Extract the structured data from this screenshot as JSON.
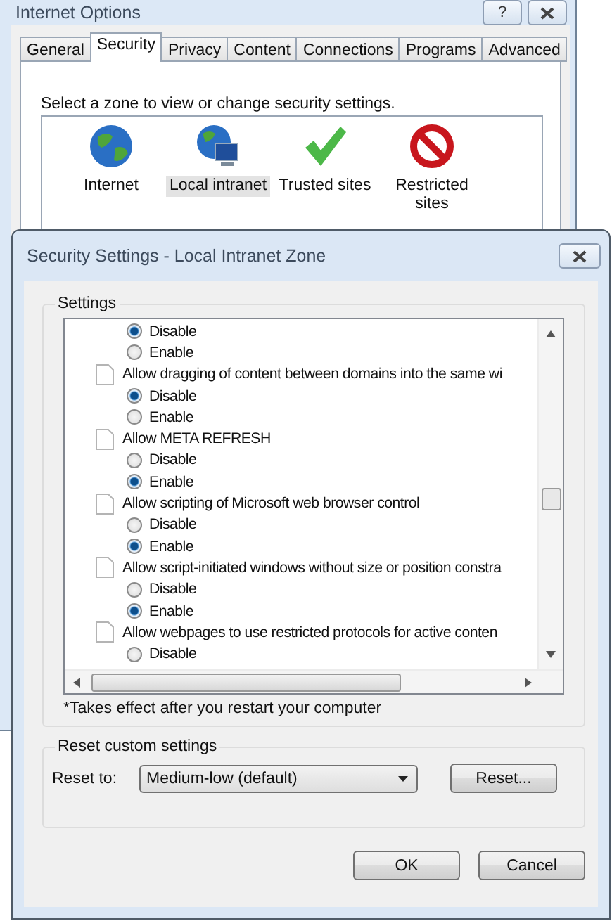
{
  "back_window": {
    "title": "Internet Options",
    "help": "?",
    "tabs": [
      {
        "label": "General",
        "selected": false
      },
      {
        "label": "Security",
        "selected": true
      },
      {
        "label": "Privacy",
        "selected": false
      },
      {
        "label": "Content",
        "selected": false
      },
      {
        "label": "Connections",
        "selected": false
      },
      {
        "label": "Programs",
        "selected": false
      },
      {
        "label": "Advanced",
        "selected": false
      }
    ],
    "prompt": "Select a zone to view or change security settings.",
    "zones": [
      {
        "kind": "globe",
        "label": "Internet",
        "selected": false
      },
      {
        "kind": "intranet",
        "label": "Local intranet",
        "selected": true
      },
      {
        "kind": "check",
        "label": "Trusted sites",
        "selected": false
      },
      {
        "kind": "blocked",
        "label": "Restricted sites",
        "selected": false
      }
    ]
  },
  "dialog": {
    "title": "Security Settings - Local Intranet Zone",
    "settings_label": "Settings",
    "items": [
      {
        "kind": "option",
        "label": "Disable",
        "selected": true
      },
      {
        "kind": "option",
        "label": "Enable",
        "selected": false
      },
      {
        "kind": "setting",
        "label": "Allow dragging of content between domains into the same wi"
      },
      {
        "kind": "option",
        "label": "Disable",
        "selected": true
      },
      {
        "kind": "option",
        "label": "Enable",
        "selected": false
      },
      {
        "kind": "setting",
        "label": "Allow META REFRESH"
      },
      {
        "kind": "option",
        "label": "Disable",
        "selected": false
      },
      {
        "kind": "option",
        "label": "Enable",
        "selected": true
      },
      {
        "kind": "setting",
        "label": "Allow scripting of Microsoft web browser control"
      },
      {
        "kind": "option",
        "label": "Disable",
        "selected": false
      },
      {
        "kind": "option",
        "label": "Enable",
        "selected": true
      },
      {
        "kind": "setting",
        "label": "Allow script-initiated windows without size or position constra"
      },
      {
        "kind": "option",
        "label": "Disable",
        "selected": false
      },
      {
        "kind": "option",
        "label": "Enable",
        "selected": true
      },
      {
        "kind": "setting",
        "label": "Allow webpages to use restricted protocols for active conten"
      },
      {
        "kind": "option",
        "label": "Disable",
        "selected": false
      }
    ],
    "note": "*Takes effect after you restart your computer",
    "reset_group": "Reset custom settings",
    "reset_to_label": "Reset to:",
    "reset_to_value": "Medium-low (default)",
    "reset_button": "Reset...",
    "buttons": [
      "OK",
      "Cancel"
    ]
  }
}
